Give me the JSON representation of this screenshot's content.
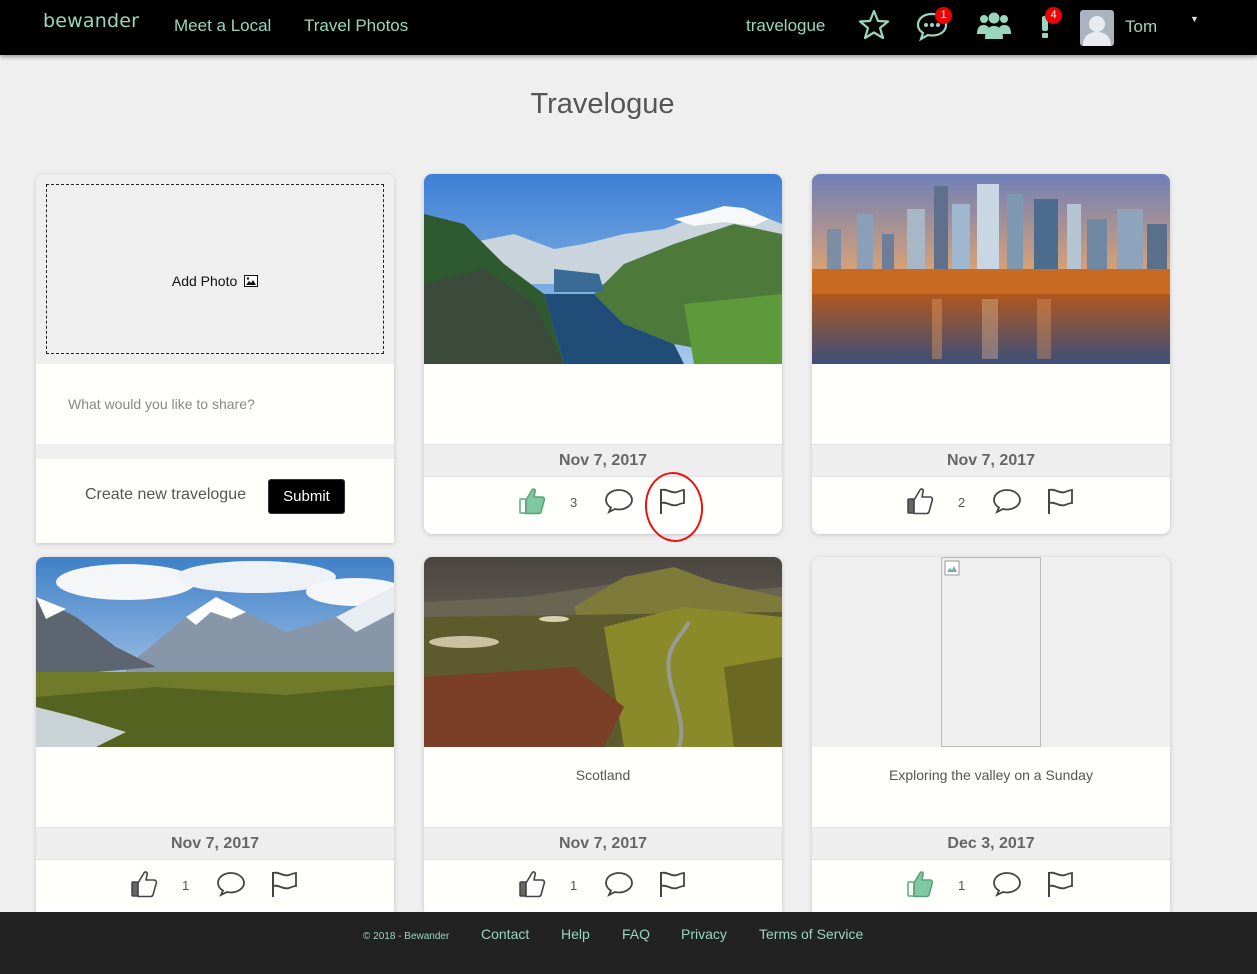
{
  "navbar": {
    "brand": "bewander",
    "links": [
      "Meet a Local",
      "Travel Photos"
    ],
    "current_section": "travelogue",
    "messages_badge": "1",
    "notifications_badge": "4",
    "user_name": "Tom",
    "accent_color": "#9ad6bf"
  },
  "page": {
    "title": "Travelogue"
  },
  "create_card": {
    "add_photo_label": "Add Photo",
    "share_placeholder": "What would you like to share?",
    "create_label": "Create new travelogue",
    "submit_label": "Submit"
  },
  "posts": [
    {
      "caption": "",
      "date": "Nov 7, 2017",
      "likes": "3",
      "liked": true,
      "photo": "fjord"
    },
    {
      "caption": "",
      "date": "Nov 7, 2017",
      "likes": "2",
      "liked": false,
      "photo": "city-sunset"
    },
    {
      "caption": "",
      "date": "Nov 7, 2017",
      "likes": "1",
      "liked": false,
      "photo": "mountains"
    },
    {
      "caption": "Scotland",
      "date": "Nov 7, 2017",
      "likes": "1",
      "liked": false,
      "photo": "highlands"
    },
    {
      "caption": "Exploring the valley on a Sunday",
      "date": "Dec 3, 2017",
      "likes": "1",
      "liked": true,
      "photo": "broken-image"
    }
  ],
  "footer": {
    "copyright": "© 2018 - Bewander",
    "links": [
      "Contact",
      "Help",
      "FAQ",
      "Privacy",
      "Terms of Service"
    ]
  }
}
